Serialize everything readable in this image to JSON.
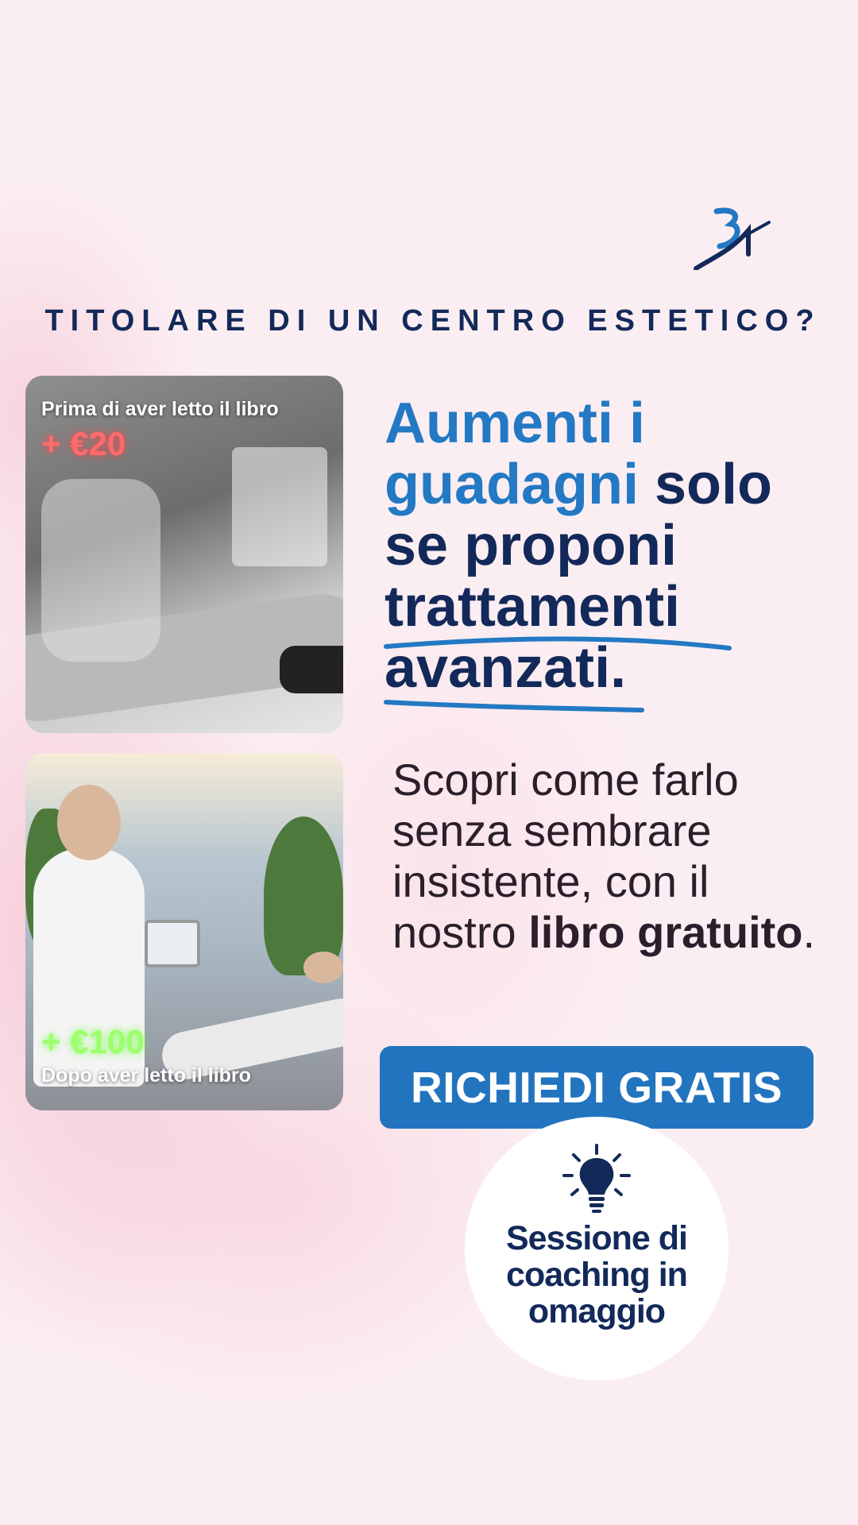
{
  "header": {
    "logo_icon": "brand-monogram-logo",
    "tagline": "TITOLARE DI UN CENTRO ESTETICO?"
  },
  "before_card": {
    "label": "Prima di aver letto il libro",
    "value": "+ €20"
  },
  "after_card": {
    "value": "+ €100",
    "label": "Dopo aver letto il libro"
  },
  "headline": {
    "line1_accent": "Aumenti i",
    "line2_accent": "guadagni",
    "line2_rest": " solo",
    "line3": "se proponi",
    "line4": "trattamenti",
    "line5": "avanzati."
  },
  "body": {
    "text_pre": "Scopri come farlo senza sembrare insistente, con il nostro ",
    "bold1": "libro",
    "space": " ",
    "bold2": "gratuito",
    "text_post": "."
  },
  "cta": {
    "label": "RICHIEDI GRATIS"
  },
  "bonus": {
    "icon": "lightbulb-icon",
    "line1": "Sessione di",
    "line2": "coaching in",
    "line3": "omaggio"
  },
  "colors": {
    "navy": "#13295a",
    "accent_blue": "#2379c4",
    "button_blue": "#2274bf",
    "background_pink": "#fbeef2",
    "price_red": "#ff6a6a",
    "price_green": "#9bff6a"
  }
}
